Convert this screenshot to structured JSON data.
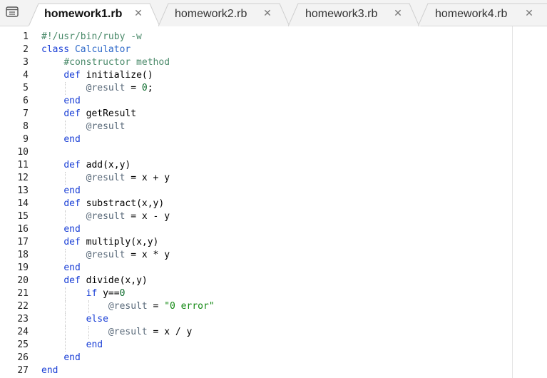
{
  "tabs": [
    {
      "label": "homework1.rb",
      "active": true
    },
    {
      "label": "homework2.rb",
      "active": false
    },
    {
      "label": "homework3.rb",
      "active": false
    },
    {
      "label": "homework4.rb",
      "active": false
    }
  ],
  "colors": {
    "keyword": "#1a3fd6",
    "comment": "#4a8a6a",
    "instance_var": "#5a6a7a",
    "string": "#118811"
  },
  "icons": {
    "menu": "menu-list-icon",
    "close": "close-icon"
  },
  "line_numbers": [
    "1",
    "2",
    "3",
    "4",
    "5",
    "6",
    "7",
    "8",
    "9",
    "10",
    "11",
    "12",
    "13",
    "14",
    "15",
    "16",
    "17",
    "18",
    "19",
    "20",
    "21",
    "22",
    "23",
    "24",
    "25",
    "26",
    "27"
  ],
  "code": [
    [
      {
        "t": "#!/usr/bin/ruby -w",
        "c": "comment"
      }
    ],
    [
      {
        "t": "class ",
        "c": "kw"
      },
      {
        "t": "Calculator",
        "c": "const"
      }
    ],
    [
      {
        "t": "    "
      },
      {
        "t": "#constructor method",
        "c": "comment"
      }
    ],
    [
      {
        "t": "    "
      },
      {
        "t": "def",
        "c": "kw"
      },
      {
        "t": " initialize()"
      }
    ],
    [
      {
        "t": "        "
      },
      {
        "t": "@result",
        "c": "ivar"
      },
      {
        "t": " = "
      },
      {
        "t": "0",
        "c": "num"
      },
      {
        "t": ";"
      }
    ],
    [
      {
        "t": "    "
      },
      {
        "t": "end",
        "c": "kw"
      }
    ],
    [
      {
        "t": "    "
      },
      {
        "t": "def",
        "c": "kw"
      },
      {
        "t": " getResult"
      }
    ],
    [
      {
        "t": "        "
      },
      {
        "t": "@result",
        "c": "ivar"
      }
    ],
    [
      {
        "t": "    "
      },
      {
        "t": "end",
        "c": "kw"
      }
    ],
    [],
    [
      {
        "t": "    "
      },
      {
        "t": "def",
        "c": "kw"
      },
      {
        "t": " add(x,y)"
      }
    ],
    [
      {
        "t": "        "
      },
      {
        "t": "@result",
        "c": "ivar"
      },
      {
        "t": " = x + y"
      }
    ],
    [
      {
        "t": "    "
      },
      {
        "t": "end",
        "c": "kw"
      }
    ],
    [
      {
        "t": "    "
      },
      {
        "t": "def",
        "c": "kw"
      },
      {
        "t": " substract(x,y)"
      }
    ],
    [
      {
        "t": "        "
      },
      {
        "t": "@result",
        "c": "ivar"
      },
      {
        "t": " = x - y"
      }
    ],
    [
      {
        "t": "    "
      },
      {
        "t": "end",
        "c": "kw"
      }
    ],
    [
      {
        "t": "    "
      },
      {
        "t": "def",
        "c": "kw"
      },
      {
        "t": " multiply(x,y)"
      }
    ],
    [
      {
        "t": "        "
      },
      {
        "t": "@result",
        "c": "ivar"
      },
      {
        "t": " = x * y"
      }
    ],
    [
      {
        "t": "    "
      },
      {
        "t": "end",
        "c": "kw"
      }
    ],
    [
      {
        "t": "    "
      },
      {
        "t": "def",
        "c": "kw"
      },
      {
        "t": " divide(x,y)"
      }
    ],
    [
      {
        "t": "        "
      },
      {
        "t": "if",
        "c": "kw"
      },
      {
        "t": " y=="
      },
      {
        "t": "0",
        "c": "num"
      }
    ],
    [
      {
        "t": "            "
      },
      {
        "t": "@result",
        "c": "ivar"
      },
      {
        "t": " = "
      },
      {
        "t": "\"0 error\"",
        "c": "str"
      }
    ],
    [
      {
        "t": "        "
      },
      {
        "t": "else",
        "c": "kw"
      }
    ],
    [
      {
        "t": "            "
      },
      {
        "t": "@result",
        "c": "ivar"
      },
      {
        "t": " = x / y"
      }
    ],
    [
      {
        "t": "        "
      },
      {
        "t": "end",
        "c": "kw"
      }
    ],
    [
      {
        "t": "    "
      },
      {
        "t": "end",
        "c": "kw"
      }
    ],
    [
      {
        "t": "end",
        "c": "kw"
      }
    ]
  ]
}
